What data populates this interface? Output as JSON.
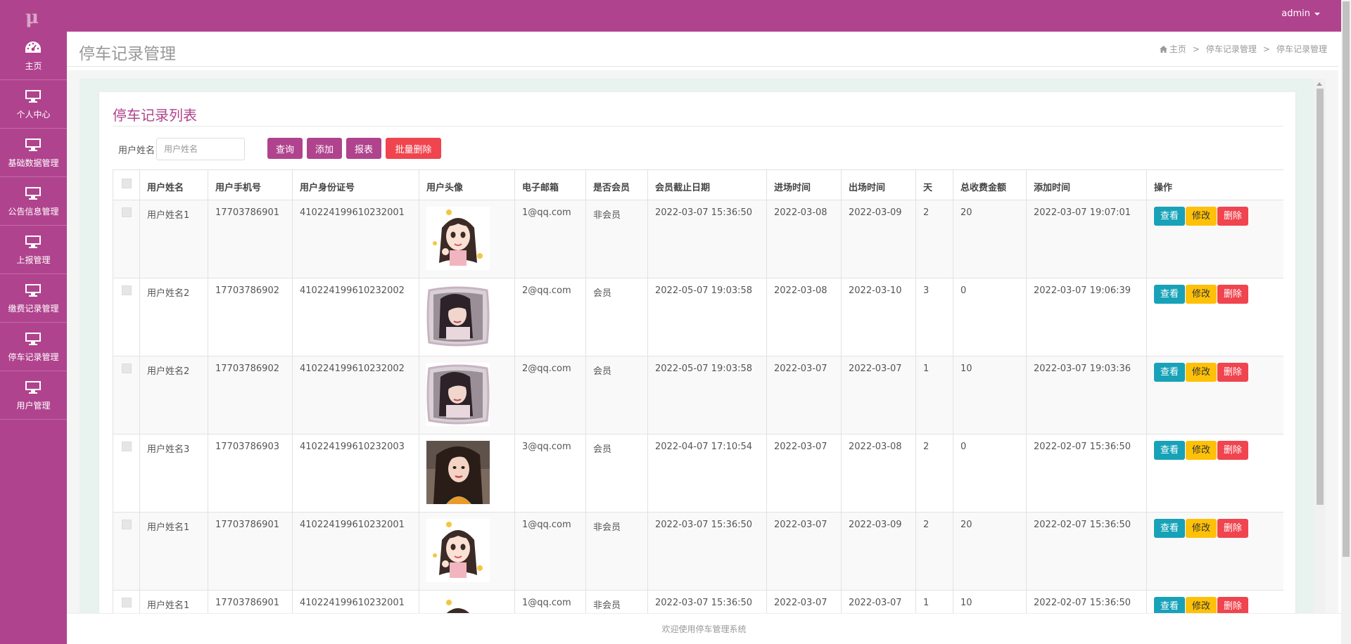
{
  "app": {
    "logo": "μ",
    "user": "admin"
  },
  "sidebar": {
    "items": [
      {
        "label": "主页",
        "icon": "dashboard-icon"
      },
      {
        "label": "个人中心",
        "icon": "monitor-icon"
      },
      {
        "label": "基础数据管理",
        "icon": "monitor-icon"
      },
      {
        "label": "公告信息管理",
        "icon": "monitor-icon"
      },
      {
        "label": "上报管理",
        "icon": "monitor-icon"
      },
      {
        "label": "缴费记录管理",
        "icon": "monitor-icon"
      },
      {
        "label": "停车记录管理",
        "icon": "monitor-icon"
      },
      {
        "label": "用户管理",
        "icon": "monitor-icon"
      }
    ]
  },
  "header": {
    "title": "停车记录管理",
    "breadcrumb": [
      "主页",
      "停车记录管理",
      "停车记录管理"
    ]
  },
  "panel": {
    "title": "停车记录列表"
  },
  "search": {
    "label": "用户姓名",
    "placeholder": "用户姓名",
    "value": ""
  },
  "toolbar": {
    "query": "查询",
    "add": "添加",
    "report": "报表",
    "batch_delete": "批量删除"
  },
  "table": {
    "columns": [
      "用户姓名",
      "用户手机号",
      "用户身份证号",
      "用户头像",
      "电子邮箱",
      "是否会员",
      "会员截止日期",
      "进场时间",
      "出场时间",
      "天",
      "总收费金额",
      "添加时间",
      "操作"
    ],
    "rows": [
      {
        "name": "用户姓名1",
        "phone": "17703786901",
        "id_card": "410224199610232001",
        "avatar": "cartoon-girl-avatar",
        "email": "1@qq.com",
        "member": "非会员",
        "member_end": "2022-03-07 15:36:50",
        "enter": "2022-03-08",
        "exit": "2022-03-09",
        "days": "2",
        "fee": "20",
        "added": "2022-03-07 19:07:01"
      },
      {
        "name": "用户姓名2",
        "phone": "17703786902",
        "id_card": "410224199610232002",
        "avatar": "pillow-portrait-avatar",
        "email": "2@qq.com",
        "member": "会员",
        "member_end": "2022-05-07 19:03:58",
        "enter": "2022-03-08",
        "exit": "2022-03-10",
        "days": "3",
        "fee": "0",
        "added": "2022-03-07 19:06:39"
      },
      {
        "name": "用户姓名2",
        "phone": "17703786902",
        "id_card": "410224199610232002",
        "avatar": "pillow-portrait-avatar",
        "email": "2@qq.com",
        "member": "会员",
        "member_end": "2022-05-07 19:03:58",
        "enter": "2022-03-07",
        "exit": "2022-03-07",
        "days": "1",
        "fee": "10",
        "added": "2022-03-07 19:03:36"
      },
      {
        "name": "用户姓名3",
        "phone": "17703786903",
        "id_card": "410224199610232003",
        "avatar": "photo-portrait-avatar",
        "email": "3@qq.com",
        "member": "会员",
        "member_end": "2022-04-07 17:10:54",
        "enter": "2022-03-07",
        "exit": "2022-03-08",
        "days": "2",
        "fee": "0",
        "added": "2022-02-07 15:36:50"
      },
      {
        "name": "用户姓名1",
        "phone": "17703786901",
        "id_card": "410224199610232001",
        "avatar": "cartoon-girl-avatar",
        "email": "1@qq.com",
        "member": "非会员",
        "member_end": "2022-03-07 15:36:50",
        "enter": "2022-03-07",
        "exit": "2022-03-09",
        "days": "2",
        "fee": "20",
        "added": "2022-02-07 15:36:50"
      },
      {
        "name": "用户姓名1",
        "phone": "17703786901",
        "id_card": "410224199610232001",
        "avatar": "cartoon-girl-avatar",
        "email": "1@qq.com",
        "member": "非会员",
        "member_end": "2022-03-07 15:36:50",
        "enter": "2022-03-07",
        "exit": "2022-03-07",
        "days": "1",
        "fee": "10",
        "added": "2022-02-07 15:36:50"
      }
    ],
    "actions": {
      "view": "查看",
      "edit": "修改",
      "delete": "删除"
    }
  },
  "footer": {
    "text": "欢迎使用停车管理系统"
  },
  "colors": {
    "brand": "#b0438e",
    "view": "#17a2b8",
    "edit": "#ffc107",
    "danger": "#f0444e"
  }
}
